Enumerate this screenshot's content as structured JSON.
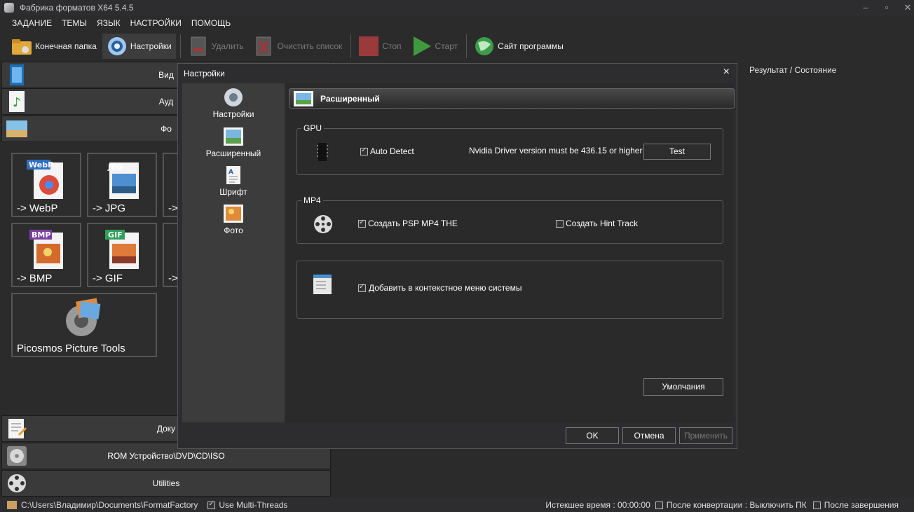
{
  "window": {
    "title": "Фабрика форматов X64 5.4.5"
  },
  "menu": [
    "ЗАДАНИЕ",
    "ТЕМЫ",
    "ЯЗЫК",
    "НАСТРОЙКИ",
    "ПОМОЩЬ"
  ],
  "toolbar": {
    "output_folder": "Конечная папка",
    "settings": "Настройки",
    "delete": "Удалить",
    "clear_list": "Очистить список",
    "stop": "Стоп",
    "start": "Старт",
    "website": "Сайт программы"
  },
  "categories": {
    "video": "Вид",
    "audio": "Ауд",
    "photo": "Фо",
    "documents": "Доку",
    "rom": "ROM Устройство\\DVD\\CD\\ISO",
    "utilities": "Utilities"
  },
  "tiles": [
    {
      "label": "-> WebP",
      "badge": "WebP"
    },
    {
      "label": "-> JPG",
      "badge": "JPG"
    },
    {
      "label": "->",
      "badge": ""
    },
    {
      "label": "-> BMP",
      "badge": "BMP"
    },
    {
      "label": "-> GIF",
      "badge": "GIF"
    },
    {
      "label": "->",
      "badge": ""
    },
    {
      "label": "Picosmos Picture Tools",
      "badge": ""
    }
  ],
  "right_header": "Результат / Состояние",
  "status": {
    "path": "C:\\Users\\Владимир\\Documents\\FormatFactory",
    "multithreads": "Use Multi-Threads",
    "elapsed": "Истекшее время : 00:00:00",
    "after_convert": "После конвертации : Выключить ПК",
    "after_finish": "После завершения"
  },
  "dialog": {
    "title": "Настройки",
    "sidebar": [
      "Настройки",
      "Расширенный",
      "Шрифт",
      "Фото"
    ],
    "section": "Расширенный",
    "gpu": {
      "label": "GPU",
      "auto_detect": "Auto Detect",
      "note": "Nvidia Driver version must be 436.15 or higher",
      "test": "Test"
    },
    "mp4": {
      "label": "MP4",
      "psp": "Создать PSP MP4 THE",
      "hint": "Создать Hint Track"
    },
    "context": {
      "add": "Добавить в контекстное меню системы"
    },
    "defaults": "Умолчания",
    "ok": "OK",
    "cancel": "Отмена",
    "apply": "Применить"
  }
}
